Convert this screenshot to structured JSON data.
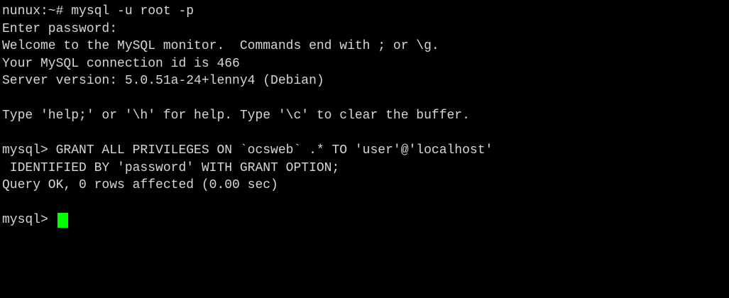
{
  "terminal": {
    "lines": [
      "nunux:~# mysql -u root -p",
      "Enter password:",
      "Welcome to the MySQL monitor.  Commands end with ; or \\g.",
      "Your MySQL connection id is 466",
      "Server version: 5.0.51a-24+lenny4 (Debian)",
      "",
      "Type 'help;' or '\\h' for help. Type '\\c' to clear the buffer.",
      "",
      "mysql> GRANT ALL PRIVILEGES ON `ocsweb` .* TO 'user'@'localhost'",
      " IDENTIFIED BY 'password' WITH GRANT OPTION;",
      "Query OK, 0 rows affected (0.00 sec)",
      ""
    ],
    "prompt": "mysql> ",
    "colors": {
      "background": "#000000",
      "text": "#d6d6d6",
      "cursor": "#00ff00"
    }
  }
}
